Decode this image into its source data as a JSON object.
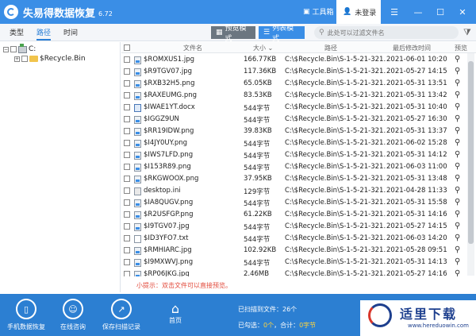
{
  "app": {
    "title": "失易得数据恢复",
    "version": "6.72"
  },
  "titlebar": {
    "toolbox_label": "工具箱",
    "login_label": "未登录"
  },
  "tabs": [
    "类型",
    "路径",
    "时间"
  ],
  "modes": {
    "preview_label": "预览模式",
    "list_label": "列表模式"
  },
  "filter": {
    "placeholder": "此处可以过滤文件名"
  },
  "tree": {
    "drive": "C:",
    "folder": "$Recycle.Bin"
  },
  "table": {
    "headers": [
      "文件名",
      "大小",
      "路径",
      "最后修改时间",
      "预览"
    ],
    "rows": [
      {
        "name": "$ROMXUS1.jpg",
        "size": "166.77KB",
        "path": "C:\\$Recycle.Bin\\S-1-5-21-321...",
        "time": "2021-06-01  10:20",
        "type": "img"
      },
      {
        "name": "$R9TGV07.jpg",
        "size": "117.36KB",
        "path": "C:\\$Recycle.Bin\\S-1-5-21-321...",
        "time": "2021-05-27  14:15",
        "type": "img"
      },
      {
        "name": "$RXB32H5.png",
        "size": "65.05KB",
        "path": "C:\\$Recycle.Bin\\S-1-5-21-321...",
        "time": "2021-05-31  13:51",
        "type": "img"
      },
      {
        "name": "$RAXEUMG.png",
        "size": "83.53KB",
        "path": "C:\\$Recycle.Bin\\S-1-5-21-321...",
        "time": "2021-05-31  13:42",
        "type": "img"
      },
      {
        "name": "$IWAE1YT.docx",
        "size": "544字节",
        "path": "C:\\$Recycle.Bin\\S-1-5-21-321...",
        "time": "2021-05-31  10:40",
        "type": "doc"
      },
      {
        "name": "$IGGZ9UN",
        "size": "544字节",
        "path": "C:\\$Recycle.Bin\\S-1-5-21-321...",
        "time": "2021-05-27  16:30",
        "type": "img"
      },
      {
        "name": "$RR19IDW.png",
        "size": "39.83KB",
        "path": "C:\\$Recycle.Bin\\S-1-5-21-321...",
        "time": "2021-05-31  13:37",
        "type": "img"
      },
      {
        "name": "$I4JY0UY.png",
        "size": "544字节",
        "path": "C:\\$Recycle.Bin\\S-1-5-21-321...",
        "time": "2021-06-02  15:28",
        "type": "img"
      },
      {
        "name": "$IWS7LFD.png",
        "size": "544字节",
        "path": "C:\\$Recycle.Bin\\S-1-5-21-321...",
        "time": "2021-05-31  14:12",
        "type": "img"
      },
      {
        "name": "$I153R89.png",
        "size": "544字节",
        "path": "C:\\$Recycle.Bin\\S-1-5-21-321...",
        "time": "2021-06-03  11:00",
        "type": "img"
      },
      {
        "name": "$RKGWOOX.png",
        "size": "37.95KB",
        "path": "C:\\$Recycle.Bin\\S-1-5-21-321...",
        "time": "2021-05-31  13:48",
        "type": "img"
      },
      {
        "name": "desktop.ini",
        "size": "129字节",
        "path": "C:\\$Recycle.Bin\\S-1-5-21-321...",
        "time": "2021-04-28  11:33",
        "type": "ini"
      },
      {
        "name": "$IA8QUGV.png",
        "size": "544字节",
        "path": "C:\\$Recycle.Bin\\S-1-5-21-321...",
        "time": "2021-05-31  15:58",
        "type": "img"
      },
      {
        "name": "$R2USFGP.png",
        "size": "61.22KB",
        "path": "C:\\$Recycle.Bin\\S-1-5-21-321...",
        "time": "2021-05-31  14:16",
        "type": "img"
      },
      {
        "name": "$I9TGV07.jpg",
        "size": "544字节",
        "path": "C:\\$Recycle.Bin\\S-1-5-21-321...",
        "time": "2021-05-27  14:15",
        "type": "img"
      },
      {
        "name": "$ID3YFO7.txt",
        "size": "544字节",
        "path": "C:\\$Recycle.Bin\\S-1-5-21-321...",
        "time": "2021-06-03  14:20",
        "type": "txt"
      },
      {
        "name": "$RMHIARC.jpg",
        "size": "102.92KB",
        "path": "C:\\$Recycle.Bin\\S-1-5-21-321...",
        "time": "2021-05-28  09:51",
        "type": "img"
      },
      {
        "name": "$I9MXWVJ.png",
        "size": "544字节",
        "path": "C:\\$Recycle.Bin\\S-1-5-21-321...",
        "time": "2021-05-31  14:13",
        "type": "img"
      },
      {
        "name": "$RP06JKG.jpg",
        "size": "2.46MB",
        "path": "C:\\$Recycle.Bin\\S-1-5-21-321...",
        "time": "2021-05-27  14:16",
        "type": "img"
      }
    ]
  },
  "hint": "小提示：双击文件可以直接预览。",
  "bottom": {
    "phone_recovery": "手机数据恢复",
    "online_consult": "在线咨询",
    "save_scan": "保存扫描记录",
    "home": "首页",
    "scan_count": "已扫描到文件：26个",
    "selected_prefix": "已勾选：",
    "selected_count": "0个",
    "total_prefix": "，合计：",
    "total_size": "0字节"
  },
  "watermark": {
    "text": "适里下载",
    "url": "www.hereduowin.com"
  },
  "colors": {
    "accent": "#3a8ee6",
    "bottom": "#2c7fd2",
    "hint": "#e24a3b"
  }
}
